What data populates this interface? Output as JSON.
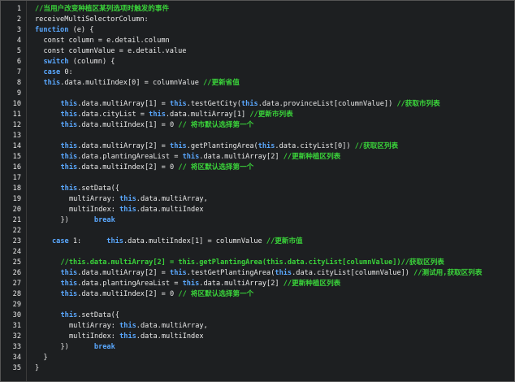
{
  "lines": [
    {
      "n": "1",
      "indent": 1,
      "segs": [
        {
          "t": "//当用户改变种植区某列选项时触发的事件",
          "c": "cm"
        }
      ]
    },
    {
      "n": "2",
      "indent": 1,
      "segs": [
        {
          "t": "receiveMultiSelectorColumn:",
          "c": "tx"
        }
      ]
    },
    {
      "n": "3",
      "indent": 1,
      "segs": [
        {
          "t": "function",
          "c": "kw"
        },
        {
          "t": " (e) {",
          "c": "tx"
        }
      ]
    },
    {
      "n": "4",
      "indent": 2,
      "segs": [
        {
          "t": "const column = e.detail.column",
          "c": "tx"
        }
      ]
    },
    {
      "n": "5",
      "indent": 2,
      "segs": [
        {
          "t": "const columnValue = e.detail.value",
          "c": "tx"
        }
      ]
    },
    {
      "n": "6",
      "indent": 2,
      "segs": [
        {
          "t": "switch",
          "c": "kw"
        },
        {
          "t": " (column) {",
          "c": "tx"
        }
      ]
    },
    {
      "n": "7",
      "indent": 2,
      "segs": [
        {
          "t": "case",
          "c": "kw"
        },
        {
          "t": " 0:",
          "c": "tx"
        }
      ]
    },
    {
      "n": "8",
      "indent": 2,
      "segs": [
        {
          "t": "this",
          "c": "kw"
        },
        {
          "t": ".data.multiIndex[0] = columnValue ",
          "c": "tx"
        },
        {
          "t": "//更新省值",
          "c": "cm"
        }
      ]
    },
    {
      "n": "9",
      "indent": 0,
      "segs": []
    },
    {
      "n": "10",
      "indent": 4,
      "segs": [
        {
          "t": "this",
          "c": "kw"
        },
        {
          "t": ".data.multiArray[1] = ",
          "c": "tx"
        },
        {
          "t": "this",
          "c": "kw"
        },
        {
          "t": ".testGetCity(",
          "c": "tx"
        },
        {
          "t": "this",
          "c": "kw"
        },
        {
          "t": ".data.provinceList[columnValue]) ",
          "c": "tx"
        },
        {
          "t": "//获取市列表",
          "c": "cm"
        }
      ]
    },
    {
      "n": "11",
      "indent": 4,
      "segs": [
        {
          "t": "this",
          "c": "kw"
        },
        {
          "t": ".data.cityList = ",
          "c": "tx"
        },
        {
          "t": "this",
          "c": "kw"
        },
        {
          "t": ".data.multiArray[1] ",
          "c": "tx"
        },
        {
          "t": "//更新市列表",
          "c": "cm"
        }
      ]
    },
    {
      "n": "12",
      "indent": 4,
      "segs": [
        {
          "t": "this",
          "c": "kw"
        },
        {
          "t": ".data.multiIndex[1] = 0 ",
          "c": "tx"
        },
        {
          "t": "// 将市默认选择第一个",
          "c": "cm"
        }
      ]
    },
    {
      "n": "13",
      "indent": 0,
      "segs": []
    },
    {
      "n": "14",
      "indent": 4,
      "segs": [
        {
          "t": "this",
          "c": "kw"
        },
        {
          "t": ".data.multiArray[2] = ",
          "c": "tx"
        },
        {
          "t": "this",
          "c": "kw"
        },
        {
          "t": ".getPlantingArea(",
          "c": "tx"
        },
        {
          "t": "this",
          "c": "kw"
        },
        {
          "t": ".data.cityList[0]) ",
          "c": "tx"
        },
        {
          "t": "//获取区列表",
          "c": "cm"
        }
      ]
    },
    {
      "n": "15",
      "indent": 4,
      "segs": [
        {
          "t": "this",
          "c": "kw"
        },
        {
          "t": ".data.plantingAreaList = ",
          "c": "tx"
        },
        {
          "t": "this",
          "c": "kw"
        },
        {
          "t": ".data.multiArray[2] ",
          "c": "tx"
        },
        {
          "t": "//更新种植区列表",
          "c": "cm"
        }
      ]
    },
    {
      "n": "16",
      "indent": 4,
      "segs": [
        {
          "t": "this",
          "c": "kw"
        },
        {
          "t": ".data.multiIndex[2] = 0 ",
          "c": "tx"
        },
        {
          "t": "// 将区默认选择第一个",
          "c": "cm"
        }
      ]
    },
    {
      "n": "17",
      "indent": 0,
      "segs": []
    },
    {
      "n": "18",
      "indent": 4,
      "segs": [
        {
          "t": "this",
          "c": "kw"
        },
        {
          "t": ".setData({",
          "c": "tx"
        }
      ]
    },
    {
      "n": "19",
      "indent": 5,
      "segs": [
        {
          "t": "multiArray: ",
          "c": "tx"
        },
        {
          "t": "this",
          "c": "kw"
        },
        {
          "t": ".data.multiArray,",
          "c": "tx"
        }
      ]
    },
    {
      "n": "20",
      "indent": 5,
      "segs": [
        {
          "t": "multiIndex: ",
          "c": "tx"
        },
        {
          "t": "this",
          "c": "kw"
        },
        {
          "t": ".data.multiIndex",
          "c": "tx"
        }
      ]
    },
    {
      "n": "21",
      "indent": 4,
      "segs": [
        {
          "t": "})      ",
          "c": "tx"
        },
        {
          "t": "break",
          "c": "kw"
        }
      ]
    },
    {
      "n": "22",
      "indent": 0,
      "segs": []
    },
    {
      "n": "23",
      "indent": 3,
      "segs": [
        {
          "t": "case",
          "c": "kw"
        },
        {
          "t": " 1:      ",
          "c": "tx"
        },
        {
          "t": "this",
          "c": "kw"
        },
        {
          "t": ".data.multiIndex[1] = columnValue ",
          "c": "tx"
        },
        {
          "t": "//更新市值",
          "c": "cm"
        }
      ]
    },
    {
      "n": "24",
      "indent": 0,
      "segs": []
    },
    {
      "n": "25",
      "indent": 4,
      "segs": [
        {
          "t": "//this.data.multiArray[2] = this.getPlantingArea(this.data.cityList[columnValue])//获取区列表",
          "c": "cm"
        }
      ]
    },
    {
      "n": "26",
      "indent": 4,
      "segs": [
        {
          "t": "this",
          "c": "kw"
        },
        {
          "t": ".data.multiArray[2] = ",
          "c": "tx"
        },
        {
          "t": "this",
          "c": "kw"
        },
        {
          "t": ".testGetPlantingArea(",
          "c": "tx"
        },
        {
          "t": "this",
          "c": "kw"
        },
        {
          "t": ".data.cityList[columnValue]) ",
          "c": "tx"
        },
        {
          "t": "//测试用,获取区列表",
          "c": "cm"
        }
      ]
    },
    {
      "n": "27",
      "indent": 4,
      "segs": [
        {
          "t": "this",
          "c": "kw"
        },
        {
          "t": ".data.plantingAreaList = ",
          "c": "tx"
        },
        {
          "t": "this",
          "c": "kw"
        },
        {
          "t": ".data.multiArray[2] ",
          "c": "tx"
        },
        {
          "t": "//更新种植区列表",
          "c": "cm"
        }
      ]
    },
    {
      "n": "28",
      "indent": 4,
      "segs": [
        {
          "t": "this",
          "c": "kw"
        },
        {
          "t": ".data.multiIndex[2] = 0 ",
          "c": "tx"
        },
        {
          "t": "// 将区默认选择第一个",
          "c": "cm"
        }
      ]
    },
    {
      "n": "29",
      "indent": 0,
      "segs": []
    },
    {
      "n": "30",
      "indent": 4,
      "segs": [
        {
          "t": "this",
          "c": "kw"
        },
        {
          "t": ".setData({",
          "c": "tx"
        }
      ]
    },
    {
      "n": "31",
      "indent": 5,
      "segs": [
        {
          "t": "multiArray: ",
          "c": "tx"
        },
        {
          "t": "this",
          "c": "kw"
        },
        {
          "t": ".data.multiArray,",
          "c": "tx"
        }
      ]
    },
    {
      "n": "32",
      "indent": 5,
      "segs": [
        {
          "t": "multiIndex: ",
          "c": "tx"
        },
        {
          "t": "this",
          "c": "kw"
        },
        {
          "t": ".data.multiIndex",
          "c": "tx"
        }
      ]
    },
    {
      "n": "33",
      "indent": 4,
      "segs": [
        {
          "t": "})      ",
          "c": "tx"
        },
        {
          "t": "break",
          "c": "kw"
        }
      ]
    },
    {
      "n": "34",
      "indent": 2,
      "segs": [
        {
          "t": "}",
          "c": "tx"
        }
      ]
    },
    {
      "n": "35",
      "indent": 1,
      "segs": [
        {
          "t": "}",
          "c": "tx"
        }
      ]
    }
  ],
  "colors": {
    "background": "#1d1f21",
    "keyword": "#5aa8ff",
    "comment": "#3ad33a",
    "text": "#e8e8e8"
  }
}
